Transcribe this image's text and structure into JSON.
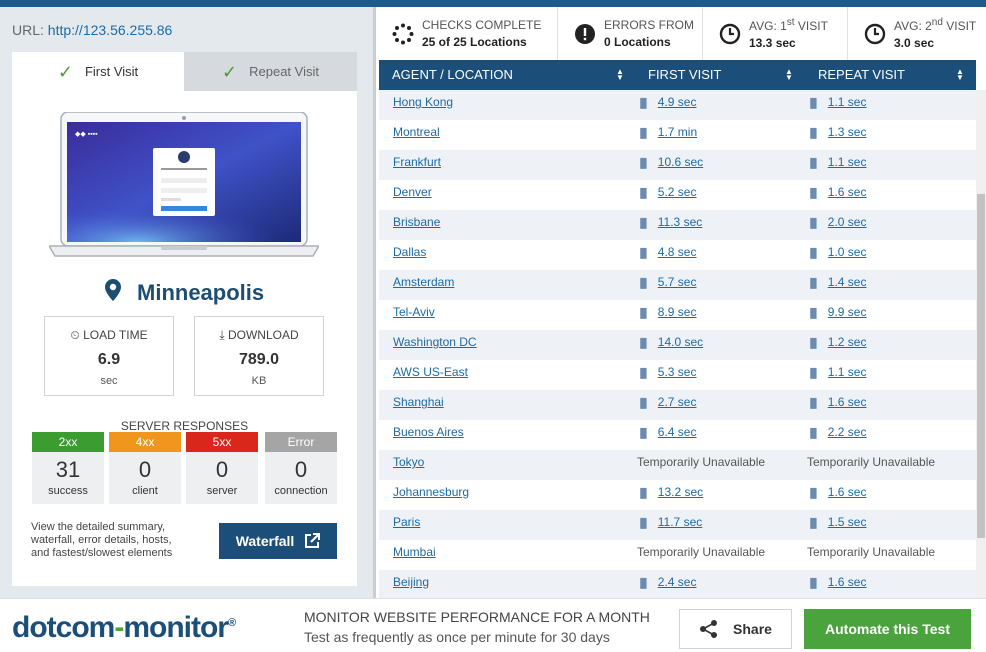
{
  "url": {
    "label": "URL:",
    "value": "http://123.56.255.86"
  },
  "tabs": [
    {
      "label": "First Visit",
      "active": true
    },
    {
      "label": "Repeat Visit",
      "active": false
    }
  ],
  "location": "Minneapolis",
  "metrics": {
    "load_time": {
      "label": "LOAD TIME",
      "value": "6.9",
      "unit": "sec"
    },
    "download": {
      "label": "DOWNLOAD",
      "value": "789.0",
      "unit": "KB"
    }
  },
  "server_responses": {
    "title": "SERVER RESPONSES",
    "items": [
      {
        "code": "2xx",
        "count": "31",
        "label": "success",
        "color": "#3b9c2f"
      },
      {
        "code": "4xx",
        "count": "0",
        "label": "client",
        "color": "#f0961e"
      },
      {
        "code": "5xx",
        "count": "0",
        "label": "server",
        "color": "#d9271c"
      },
      {
        "code": "Error",
        "count": "0",
        "label": "connection",
        "color": "#a5a5a5"
      }
    ]
  },
  "description": "View the detailed summary, waterfall, error details, hosts, and fastest/slowest elements",
  "waterfall_label": "Waterfall",
  "stats": {
    "checks": {
      "l1": "CHECKS COMPLETE",
      "l2": "25 of 25 Locations"
    },
    "errors": {
      "l1": "ERRORS FROM",
      "l2": "0 Locations"
    },
    "avg1": {
      "l1a": "AVG: 1",
      "l1sup": "st",
      "l1b": " VISIT",
      "l2": "13.3 sec"
    },
    "avg2": {
      "l1a": "AVG: 2",
      "l1sup": "nd",
      "l1b": " VISIT",
      "l2": "3.0 sec"
    }
  },
  "table": {
    "headers": [
      "AGENT / LOCATION",
      "FIRST VISIT",
      "REPEAT VISIT"
    ],
    "rows": [
      {
        "loc": "Hong Kong",
        "first": "4.9 sec",
        "repeat": "1.1 sec"
      },
      {
        "loc": "Montreal",
        "first": "1.7 min",
        "repeat": "1.3 sec"
      },
      {
        "loc": "Frankfurt",
        "first": "10.6 sec",
        "repeat": "1.1 sec"
      },
      {
        "loc": "Denver",
        "first": "5.2 sec",
        "repeat": "1.6 sec"
      },
      {
        "loc": "Brisbane",
        "first": "11.3 sec",
        "repeat": "2.0 sec"
      },
      {
        "loc": "Dallas",
        "first": "4.8 sec",
        "repeat": "1.0 sec"
      },
      {
        "loc": "Amsterdam",
        "first": "5.7 sec",
        "repeat": "1.4 sec"
      },
      {
        "loc": "Tel-Aviv",
        "first": "8.9 sec",
        "repeat": "9.9 sec"
      },
      {
        "loc": "Washington DC",
        "first": "14.0 sec",
        "repeat": "1.2 sec"
      },
      {
        "loc": "AWS US-East",
        "first": "5.3 sec",
        "repeat": "1.1 sec"
      },
      {
        "loc": "Shanghai",
        "first": "2.7 sec",
        "repeat": "1.6 sec"
      },
      {
        "loc": "Buenos Aires",
        "first": "6.4 sec",
        "repeat": "2.2 sec"
      },
      {
        "loc": "Tokyo",
        "first": "Temporarily Unavailable",
        "repeat": "Temporarily Unavailable",
        "na": true
      },
      {
        "loc": "Johannesburg",
        "first": "13.2 sec",
        "repeat": "1.6 sec"
      },
      {
        "loc": "Paris",
        "first": "11.7 sec",
        "repeat": "1.5 sec"
      },
      {
        "loc": "Mumbai",
        "first": "Temporarily Unavailable",
        "repeat": "Temporarily Unavailable",
        "na": true
      },
      {
        "loc": "Beijing",
        "first": "2.4 sec",
        "repeat": "1.6 sec"
      }
    ]
  },
  "footer": {
    "brand_a": "dotcom",
    "brand_dash": "-",
    "brand_b": "monitor",
    "brand_reg": "®",
    "promo_title": "MONITOR WEBSITE PERFORMANCE FOR A MONTH",
    "promo_sub": "Test as frequently as once per minute for 30 days",
    "share": "Share",
    "automate": "Automate this Test"
  }
}
